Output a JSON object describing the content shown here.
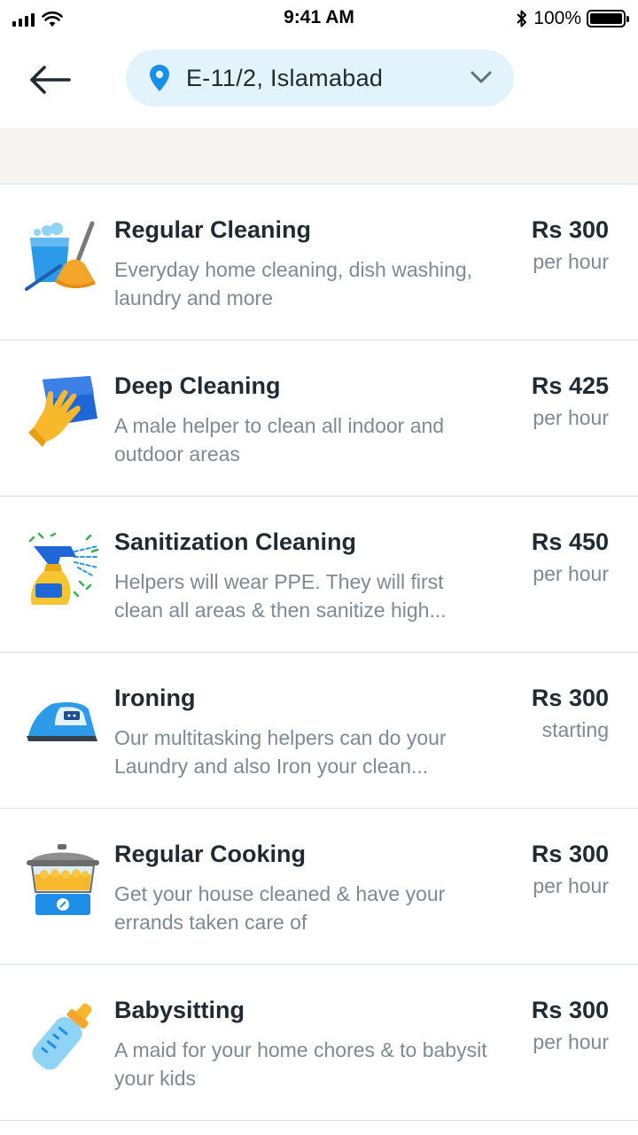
{
  "status_bar": {
    "time": "9:41 AM",
    "battery": "100%"
  },
  "header": {
    "location": "E-11/2, Islamabad"
  },
  "services": [
    {
      "title": "Regular Cleaning",
      "description": "Everyday home cleaning, dish washing, laundry and more",
      "price": "Rs 300",
      "unit": "per hour",
      "icon": "bucket-broom-icon"
    },
    {
      "title": "Deep Cleaning",
      "description": "A male helper to clean all indoor and outdoor areas",
      "price": "Rs 425",
      "unit": "per hour",
      "icon": "glove-cloth-icon"
    },
    {
      "title": "Sanitization Cleaning",
      "description": "Helpers will wear PPE. They will first clean all areas & then sanitize high...",
      "price": "Rs 450",
      "unit": "per hour",
      "icon": "spray-bottle-icon"
    },
    {
      "title": "Ironing",
      "description": "Our multitasking helpers can do your Laundry and also Iron your clean...",
      "price": "Rs 300",
      "unit": "starting",
      "icon": "iron-icon"
    },
    {
      "title": "Regular Cooking",
      "description": "Get your house cleaned & have your errands taken care of",
      "price": "Rs 300",
      "unit": "per hour",
      "icon": "cooking-pot-icon"
    },
    {
      "title": "Babysitting",
      "description": "A maid for your home chores & to babysit your kids",
      "price": "Rs 300",
      "unit": "per hour",
      "icon": "baby-bottle-icon"
    }
  ],
  "colors": {
    "accent": "#1a8fe8",
    "pill_bg": "#e3f3fc",
    "muted_text": "#7d8a93"
  }
}
